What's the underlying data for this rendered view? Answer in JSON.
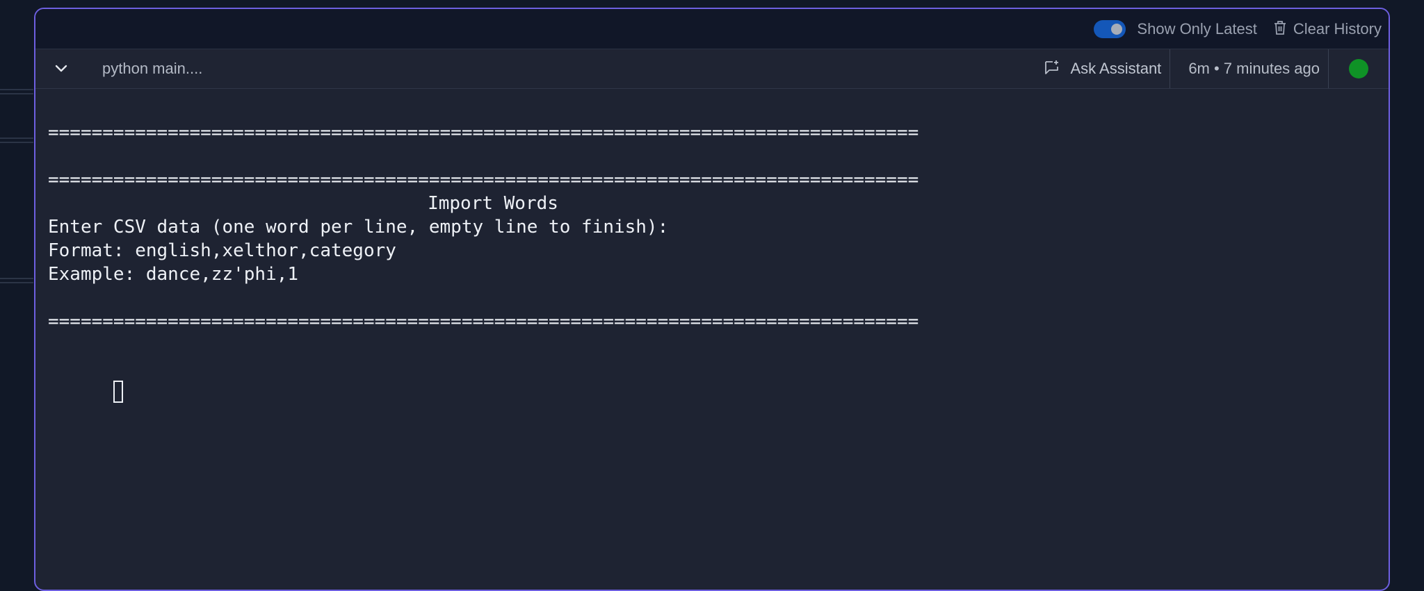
{
  "topbar": {
    "toggle_label": "Show Only Latest",
    "toggle_on": true,
    "clear_label": "Clear History"
  },
  "header": {
    "command": "python main....",
    "assistant_label": "Ask Assistant",
    "time": "6m • 7 minutes ago",
    "status_color": "#0f9226"
  },
  "terminal": {
    "separator_top": "================================================================================",
    "title": "Import Words",
    "separator_mid": "================================================================================",
    "line_prompt": "Enter CSV data (one word per line, empty line to finish):",
    "line_format": "Format: english,xelthor,category",
    "line_example": "Example: dance,zz'phi,1",
    "separator_bottom": "================================================================================"
  },
  "icons": {
    "chevron": "chevron-down-icon",
    "assistant": "chat-sparkle-icon",
    "trash": "trash-icon"
  },
  "colors": {
    "accent_border": "#6d5fe0",
    "toggle_on": "#1457b8",
    "status_running": "#0f9226"
  }
}
